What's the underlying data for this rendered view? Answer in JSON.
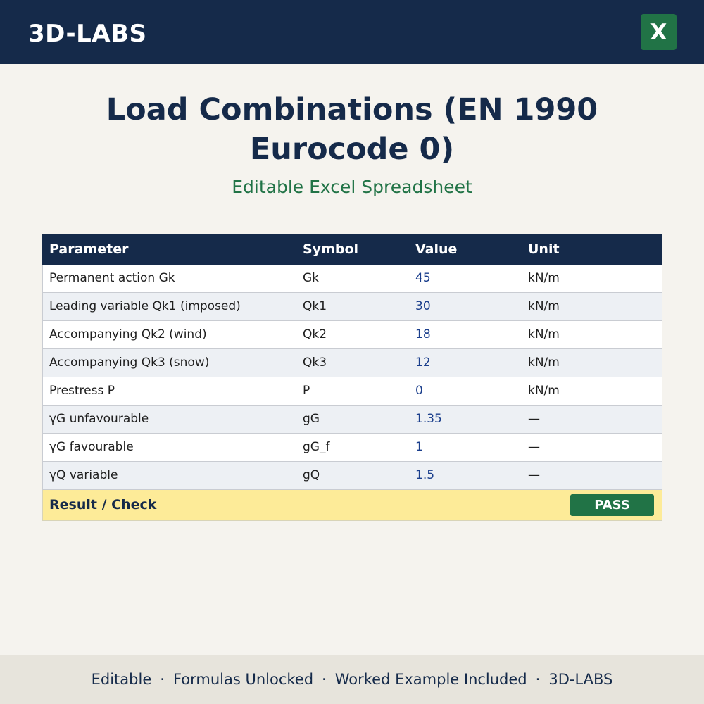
{
  "header": {
    "brand": "3D-LABS",
    "excel_icon": {
      "glyph": "X",
      "icon": "excel-icon",
      "color": "#217346"
    }
  },
  "title": "Load Combinations (EN 1990 Eurocode 0)",
  "subtitle": "Editable Excel Spreadsheet",
  "table": {
    "columns": [
      "Parameter",
      "Symbol",
      "Value",
      "Unit"
    ],
    "rows": [
      {
        "parameter": "Permanent action Gk",
        "symbol": "Gk",
        "value": "45",
        "unit": "kN/m"
      },
      {
        "parameter": "Leading variable Qk1 (imposed)",
        "symbol": "Qk1",
        "value": "30",
        "unit": "kN/m"
      },
      {
        "parameter": "Accompanying Qk2 (wind)",
        "symbol": "Qk2",
        "value": "18",
        "unit": "kN/m"
      },
      {
        "parameter": "Accompanying Qk3 (snow)",
        "symbol": "Qk3",
        "value": "12",
        "unit": "kN/m"
      },
      {
        "parameter": "Prestress P",
        "symbol": "P",
        "value": "0",
        "unit": "kN/m"
      },
      {
        "parameter": "γG unfavourable",
        "symbol": "gG",
        "value": "1.35",
        "unit": "—"
      },
      {
        "parameter": "γG favourable",
        "symbol": "gG_f",
        "value": "1",
        "unit": "—"
      },
      {
        "parameter": "γQ variable",
        "symbol": "gQ",
        "value": "1.5",
        "unit": "—"
      }
    ],
    "result": {
      "label": "Result / Check",
      "status": "PASS",
      "status_color": "#217346"
    }
  },
  "footer": {
    "items": [
      "Editable",
      "Formulas Unlocked",
      "Worked Example Included",
      "3D-LABS"
    ],
    "separator": "·"
  },
  "colors": {
    "navy": "#152a4a",
    "green": "#217346",
    "background": "#f5f3ee",
    "result_row": "#fdeb98",
    "value_text": "#1a3e8c"
  }
}
